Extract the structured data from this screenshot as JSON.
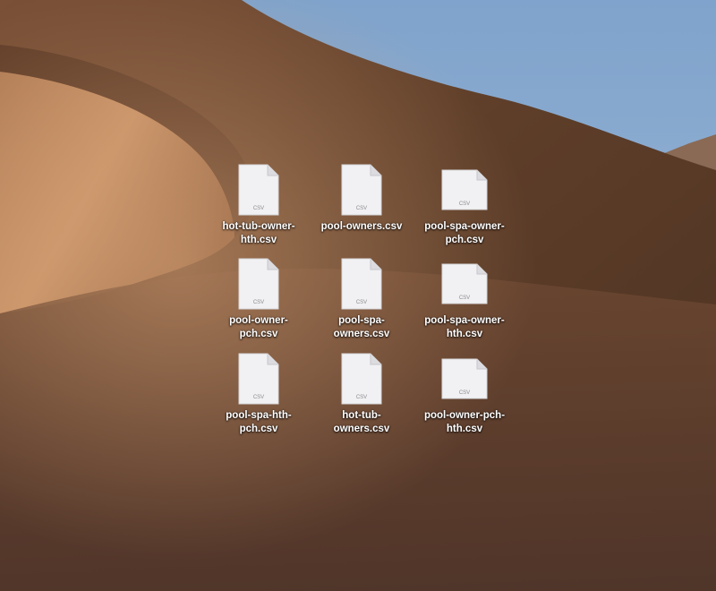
{
  "desktop": {
    "files": [
      {
        "name": "hot-tub-owner-hth.csv",
        "line1": "hot-tub-owner-",
        "line2": "hth.csv",
        "badge": "CSV",
        "icon": "csv-file-icon"
      },
      {
        "name": "pool-owners.csv",
        "line1": "pool-owners.csv",
        "line2": "",
        "badge": "CSV",
        "icon": "csv-file-icon"
      },
      {
        "name": "pool-spa-owner-pch.csv",
        "line1": "pool-spa-owner-",
        "line2": "pch.csv",
        "badge": "CSV",
        "icon": "csv-file-icon"
      },
      {
        "name": "pool-owner-pch.csv",
        "line1": "pool-owner-",
        "line2": "pch.csv",
        "badge": "CSV",
        "icon": "csv-file-icon"
      },
      {
        "name": "pool-spa-owners.csv",
        "line1": "pool-spa-",
        "line2": "owners.csv",
        "badge": "CSV",
        "icon": "csv-file-icon"
      },
      {
        "name": "pool-spa-owner-hth.csv",
        "line1": "pool-spa-owner-",
        "line2": "hth.csv",
        "badge": "CSV",
        "icon": "csv-file-icon"
      },
      {
        "name": "pool-spa-hth-pch.csv",
        "line1": "pool-spa-hth-",
        "line2": "pch.csv",
        "badge": "CSV",
        "icon": "csv-file-icon"
      },
      {
        "name": "hot-tub-owners.csv",
        "line1": "hot-tub-",
        "line2": "owners.csv",
        "badge": "CSV",
        "icon": "csv-file-icon"
      },
      {
        "name": "pool-owner-pch-hth.csv",
        "line1": "pool-owner-pch-",
        "line2": "hth.csv",
        "badge": "CSV",
        "icon": "csv-file-icon"
      }
    ]
  },
  "colors": {
    "sky": "#8fb0d3",
    "dune_dark": "#4a3020",
    "dune_light": "#c8956a",
    "label_text": "#ffffff",
    "icon_paper": "#f1f1f3"
  }
}
